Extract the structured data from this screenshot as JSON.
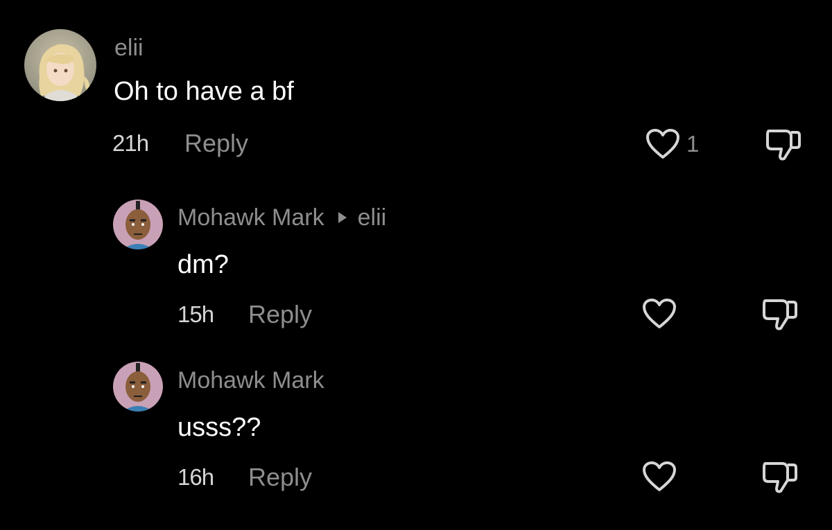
{
  "comments": [
    {
      "user": "elii",
      "text": "Oh to have a bf",
      "time": "21h",
      "reply_label": "Reply",
      "like_count": "1",
      "avatar": "anime-girl-avatar"
    },
    {
      "user": "Mohawk Mark",
      "reply_to": "elii",
      "text": "dm?",
      "time": "15h",
      "reply_label": "Reply",
      "avatar": "mohawk-man-avatar"
    },
    {
      "user": "Mohawk Mark",
      "text": "usss??",
      "time": "16h",
      "reply_label": "Reply",
      "avatar": "mohawk-man-avatar"
    }
  ],
  "icons": {
    "like": "heart-outline-icon",
    "dislike": "thumbs-down-outline-icon",
    "reply_arrow": "play-arrow-icon"
  },
  "colors": {
    "background": "#000000",
    "primary_text": "#ffffff",
    "secondary_text": "#8e8e8e",
    "icon": "#d6d6d6"
  }
}
